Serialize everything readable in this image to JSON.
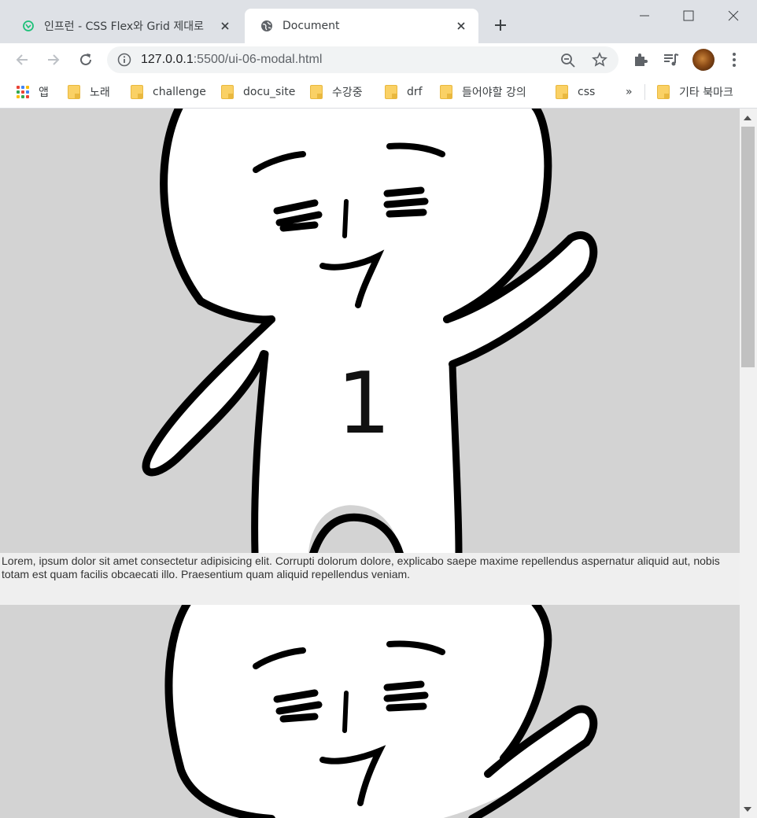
{
  "browser": {
    "tabs": [
      {
        "title": "인프런 - CSS Flex와 Grid 제대로",
        "favicon": "inflearn-icon",
        "active": false
      },
      {
        "title": "Document",
        "favicon": "globe-icon",
        "active": true
      }
    ],
    "address": {
      "host": "127.0.0.1",
      "path": ":5500/ui-06-modal.html"
    },
    "bookmarks": {
      "apps_label": "앱",
      "items": [
        "노래",
        "challenge",
        "docu_site",
        "수강중",
        "drf",
        "들어야할 강의",
        "css"
      ],
      "overflow_label": "»",
      "other_label": "기타 북마크"
    }
  },
  "page": {
    "image_background": "#d3d3d3",
    "figure_number": "1",
    "caption": "Lorem, ipsum dolor sit amet consectetur adipisicing elit. Corrupti dolorum dolore, explicabo saepe maxime repellendus aspernatur aliquid aut, nobis totam est quam facilis obcaecati illo. Praesentium quam aliquid repellendus veniam."
  },
  "colors": {
    "tabstrip": "#dee1e6",
    "omnibox": "#f1f3f4",
    "folder": "#fad165"
  }
}
